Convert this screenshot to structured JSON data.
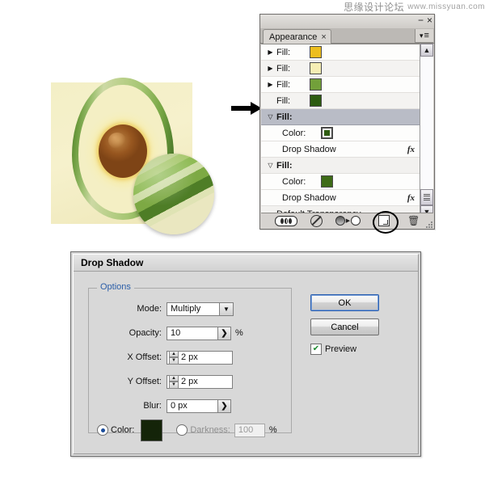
{
  "watermark": {
    "chinese": "思缘设计论坛",
    "english": "www.missyuan.com"
  },
  "artwork": {
    "name": "avocado-illustration",
    "colors": {
      "background": "#f3efc6",
      "skin_dark": "#3f6a23",
      "skin_mid": "#7aa84a",
      "skin_light": "#cdd9a4",
      "flesh_yellow": "#f2c414",
      "flesh_pale": "#f4efc4",
      "pit_brown": "#97561f"
    },
    "magnifier": {
      "name": "magnifier-bubble",
      "band_colors": [
        "#e7e6b9",
        "#bdd18e",
        "#a8c86e",
        "#8fbb55",
        "#cfdda7",
        "#7da944",
        "#4e7d26",
        "#dfe3b4"
      ]
    }
  },
  "panel": {
    "tab_label": "Appearance",
    "tab_close": "×",
    "minimize": "−",
    "close": "×",
    "menu_arrow": "▾",
    "menu_bars": "≡",
    "rows": [
      {
        "label": "Fill:",
        "triangle": "▶",
        "swatch": "#edbe1e",
        "type": "fill",
        "selected": false,
        "bold": false
      },
      {
        "label": "Fill:",
        "triangle": "▶",
        "swatch": "#f6eeb4",
        "type": "fill",
        "selected": false,
        "bold": false
      },
      {
        "label": "Fill:",
        "triangle": "▶",
        "swatch": "#72a03a",
        "type": "fill",
        "selected": false,
        "bold": false
      },
      {
        "label": "Fill:",
        "triangle": "",
        "swatch": "#2d5c10",
        "type": "fill",
        "selected": false,
        "bold": false
      },
      {
        "label": "Fill:",
        "triangle": "▽",
        "swatch": null,
        "type": "fill-expanded",
        "selected": true,
        "bold": true
      },
      {
        "label": "Color:",
        "triangle": "",
        "swatch": "#2f5d12",
        "type": "color",
        "selected": false,
        "bold": false,
        "swatch_selected": true
      },
      {
        "label": "Drop Shadow",
        "triangle": "",
        "swatch": null,
        "type": "effect",
        "fx": "fx",
        "selected": false,
        "bold": false
      },
      {
        "label": "Fill:",
        "triangle": "▽",
        "swatch": null,
        "type": "fill-expanded",
        "selected": false,
        "bold": true
      },
      {
        "label": "Color:",
        "triangle": "",
        "swatch": "#3e6b17",
        "type": "color",
        "selected": false,
        "bold": false
      },
      {
        "label": "Drop Shadow",
        "triangle": "",
        "swatch": null,
        "type": "effect",
        "fx": "fx",
        "selected": false,
        "bold": false
      },
      {
        "label": "Default Transparency",
        "triangle": "",
        "swatch": null,
        "type": "transparency",
        "selected": false,
        "bold": false
      }
    ],
    "scrollbar": {
      "up": "▲",
      "down": "▼"
    },
    "footer": {
      "opacity_title": "opacity-toggle",
      "clear_title": "clear-appearance",
      "duplicate_title": "reduce-to-basic-appearance",
      "new_art_title": "new-art-maintains-appearance",
      "trash_title": "delete-item",
      "trash_glyph": "🗑"
    }
  },
  "dialog": {
    "title": "Drop Shadow",
    "options_legend": "Options",
    "fields": {
      "mode": {
        "label": "Mode:",
        "value": "Multiply",
        "arrow": "▼"
      },
      "opacity": {
        "label": "Opacity:",
        "value": "10",
        "unit": "%",
        "popbtn": "❯"
      },
      "x_offset": {
        "label": "X Offset:",
        "value": "2 px",
        "up": "▲",
        "down": "▼"
      },
      "y_offset": {
        "label": "Y Offset:",
        "value": "2 px",
        "up": "▲",
        "down": "▼"
      },
      "blur": {
        "label": "Blur:",
        "value": "0 px",
        "popbtn": "❯"
      },
      "color": {
        "label": "Color:",
        "selected": true,
        "swatch": "#142409"
      },
      "darkness": {
        "label": "Darkness:",
        "selected": false,
        "value": "100",
        "unit": "%"
      }
    },
    "buttons": {
      "ok": "OK",
      "cancel": "Cancel"
    },
    "preview": {
      "label": "Preview",
      "checked": true,
      "check_glyph": "✔"
    }
  }
}
